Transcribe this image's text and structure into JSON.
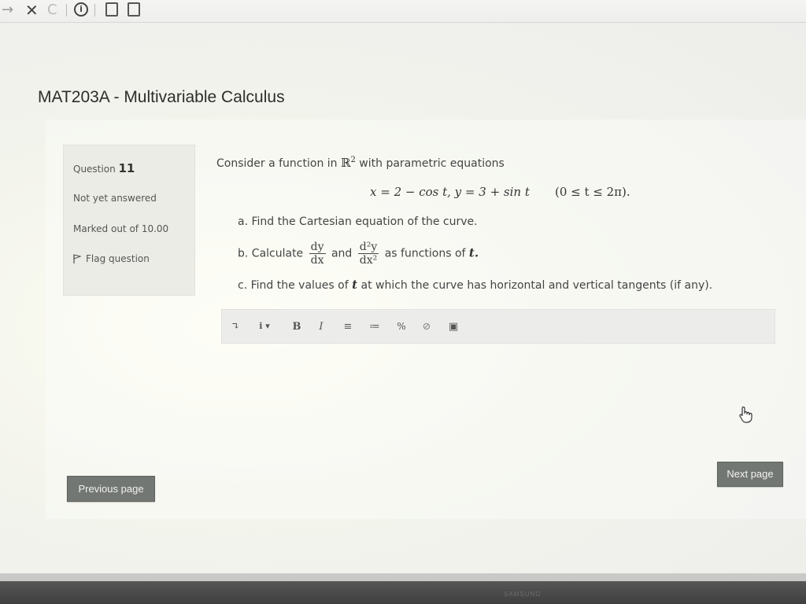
{
  "browser": {
    "back_icon": "arrow-right-icon",
    "close_glyph": "✕",
    "reload_glyph": "C"
  },
  "course": {
    "title": "MAT203A - Multivariable Calculus"
  },
  "question_info": {
    "label": "Question",
    "number": "11",
    "status": "Not yet answered",
    "marked": "Marked out of 10.00",
    "flag_label": "Flag question"
  },
  "question": {
    "intro_before": "Consider a function in",
    "intro_after": "with parametric equations",
    "space_symbol": "ℝ",
    "space_exp": "2",
    "equation": "x = 2 − cos t,  y = 3 + sin t",
    "domain": "(0 ≤ t ≤ 2π).",
    "part_a": "a. Find the Cartesian equation of the curve.",
    "part_b_before": "b. Calculate",
    "part_b_and": "and",
    "part_b_after": "as functions of",
    "part_b_var": "t.",
    "frac1_num": "dy",
    "frac1_den": "dx",
    "frac2_num": "d²y",
    "frac2_den": "dx²",
    "part_c_before": "c. Find the values of",
    "part_c_var": "t",
    "part_c_after": "at which the curve has horizontal and vertical tangents (if any)."
  },
  "editor": {
    "toolbar_glyphs": [
      "↴",
      "i ▾",
      "B",
      "I",
      "≡",
      "≔",
      "%",
      "⊘",
      "▣"
    ]
  },
  "nav": {
    "previous": "Previous page",
    "next": "Next page"
  },
  "device": {
    "brand": "SAMSUNG"
  }
}
